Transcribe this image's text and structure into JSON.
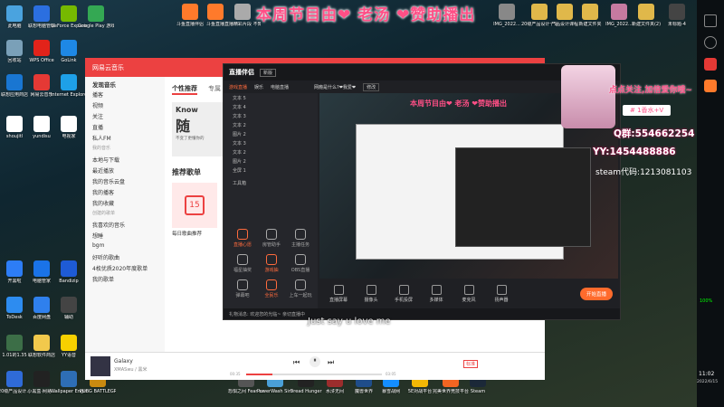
{
  "overlay": {
    "title": "本周节目由❤ 老汤 ❤赞助播出",
    "caption": "Just say u love me",
    "follow_tip": "点点关注,加倍爱你哦~",
    "gift_tip": "# 1香水+V",
    "qq_label": "Q群:554662254",
    "yy_label": "YY:1454488886",
    "steam_label": "steam代码:1213081103"
  },
  "desktop_icons_left": [
    {
      "label": "此电脑",
      "color": "#4aa3df"
    },
    {
      "label": "联想电脑管家",
      "color": "#2b6fe0"
    },
    {
      "label": "GeForce Experience",
      "color": "#76b900"
    },
    {
      "label": "Google Play 游戏",
      "color": "#34a853"
    },
    {
      "label": "回收站",
      "color": "#7aa0b8"
    },
    {
      "label": "WPS Office",
      "color": "#e2231a"
    },
    {
      "label": "GoLink",
      "color": "#1e88e5"
    },
    {
      "label": "联想应用商店",
      "color": "#1976d2"
    },
    {
      "label": "网易云音乐",
      "color": "#e53935"
    },
    {
      "label": "Internet Explorer",
      "color": "#1ea0e8"
    },
    {
      "label": "shoujitl",
      "color": "#ffffff"
    },
    {
      "label": "yundisu",
      "color": "#ffffff"
    },
    {
      "label": "电视家",
      "color": "#ffffff"
    },
    {
      "label": "开黑啦",
      "color": "#2d7df6"
    },
    {
      "label": "电脑管家",
      "color": "#1a73e8"
    },
    {
      "label": "Bandizip",
      "color": "#1e5bd6"
    },
    {
      "label": "ToDesk",
      "color": "#2d8cf0"
    },
    {
      "label": "百度网盘",
      "color": "#2f80ed"
    },
    {
      "label": "辅助",
      "color": "#444444"
    },
    {
      "label": "1.01的1.35",
      "color": "#3c6e47"
    },
    {
      "label": "联想软件商店",
      "color": "#f2c94c"
    },
    {
      "label": "YY语音",
      "color": "#f7d000"
    },
    {
      "label": "20级产品设计...",
      "color": "#2f6bd8"
    },
    {
      "label": "小黑盒·网易...",
      "color": "#222222"
    },
    {
      "label": "Wallpaper Engine:...",
      "color": "#2e6eb5"
    },
    {
      "label": "PUBG BATTLEGR...",
      "color": "#c98a10"
    }
  ],
  "desktop_icons_top": [
    {
      "label": "斗鱼直播伴侣",
      "color": "#ff7a2b"
    },
    {
      "label": "斗鱼直播",
      "color": "#ff7a2b"
    },
    {
      "label": "直播精彩片段 不知道...",
      "color": "#aaaaaa"
    },
    {
      "label": "IMG_2022...",
      "color": "#888888"
    },
    {
      "label": "20级产品设计一班期末展",
      "color": "#e0b84a"
    },
    {
      "label": "产品设计课程",
      "color": "#e0b84a"
    },
    {
      "label": "新建文件夹",
      "color": "#e0b84a"
    },
    {
      "label": "IMG_2022...",
      "color": "#c67aa0"
    },
    {
      "label": "新建文件夹(2)",
      "color": "#e0b84a"
    },
    {
      "label": "未标题-4",
      "color": "#444444"
    }
  ],
  "desktop_icons_bottom": [
    {
      "label": "恐惧之间 Fear sur...",
      "color": "#555555"
    },
    {
      "label": "PowerWash Simulator",
      "color": "#4aa0d8"
    },
    {
      "label": "Dread Hunger",
      "color": "#222222"
    },
    {
      "label": "水浒无间",
      "color": "#9b2d2d"
    },
    {
      "label": "魔兽世界",
      "color": "#1f4d8a"
    },
    {
      "label": "暴雪战网",
      "color": "#148eff"
    },
    {
      "label": "5E对战平台",
      "color": "#f2b705"
    },
    {
      "label": "完美世界竞技平台",
      "color": "#f26522"
    },
    {
      "label": "Steam",
      "color": "#1b2838"
    }
  ],
  "music_app": {
    "logo": "网易云音乐",
    "nav": [
      "发现音乐",
      "播客",
      "视频",
      "关注",
      "直播",
      "私人FM"
    ],
    "my_music_header": "我的音乐",
    "my_music": [
      "本地与下载",
      "最近播放",
      "我的音乐云盘",
      "我的播客",
      "我的收藏"
    ],
    "playlist_header": "创建的歌单",
    "playlists": [
      "我喜欢的音乐",
      "想睡",
      "bgm",
      "好听的歌曲",
      "4枚优质2020年度歌单",
      "我的歌单"
    ],
    "tab_active": "个性推荐",
    "tab_next": "专属",
    "banner_title": "Know",
    "banner_sub": "随",
    "banner_foot": "不变了更懂你的",
    "section_title": "推荐歌单",
    "daily_label": "每日歌曲推荐",
    "daily_day": "15",
    "song_title": "Galaxy",
    "song_artist": "XMASwu / 黑米",
    "time_now": "00:35",
    "time_total": "03:05",
    "quality": "标准"
  },
  "live_app": {
    "logo": "直播伴侣",
    "version": "新版",
    "tabs": [
      "游戏直播",
      "娱乐",
      "电脑直播"
    ],
    "room_title": "网瘾是什么?❤我爱❤",
    "tag": "修改",
    "scenes": [
      "文本 5",
      "文本 4",
      "文本 3",
      "文本 2",
      "图片 2"
    ],
    "scene_toggles": [
      "文本 3",
      "文本 2",
      "图片 2",
      "全屏 1"
    ],
    "tools_header": "工具箱",
    "tools": [
      {
        "label": "直播心愿",
        "color": "#ff6b3d"
      },
      {
        "label": "房管助手",
        "color": "#aaaaaa"
      },
      {
        "label": "主播任务",
        "color": "#aaaaaa"
      },
      {
        "label": "福星抽奖",
        "color": "#aaaaaa"
      },
      {
        "label": "游戏抽",
        "color": "#ff6b3d"
      },
      {
        "label": "OBS直播",
        "color": "#aaaaaa"
      },
      {
        "label": "弹幕吧",
        "color": "#aaaaaa"
      },
      {
        "label": "全民乐",
        "color": "#ff6b3d"
      },
      {
        "label": "上车一起玩",
        "color": "#aaaaaa"
      }
    ],
    "controls": [
      "直播屏幕",
      "摄像头",
      "手机投屏",
      "多媒体",
      "麦克风",
      "扬声器"
    ],
    "start_button": "开始直播",
    "status": "礼物消息: 欢迎您的光临~ 亲切直播中",
    "preview_title": "本周节目由❤ 老汤 ❤赞助播出"
  },
  "system": {
    "time": "11:02",
    "date": "2022/6/15",
    "battery": "100%"
  }
}
